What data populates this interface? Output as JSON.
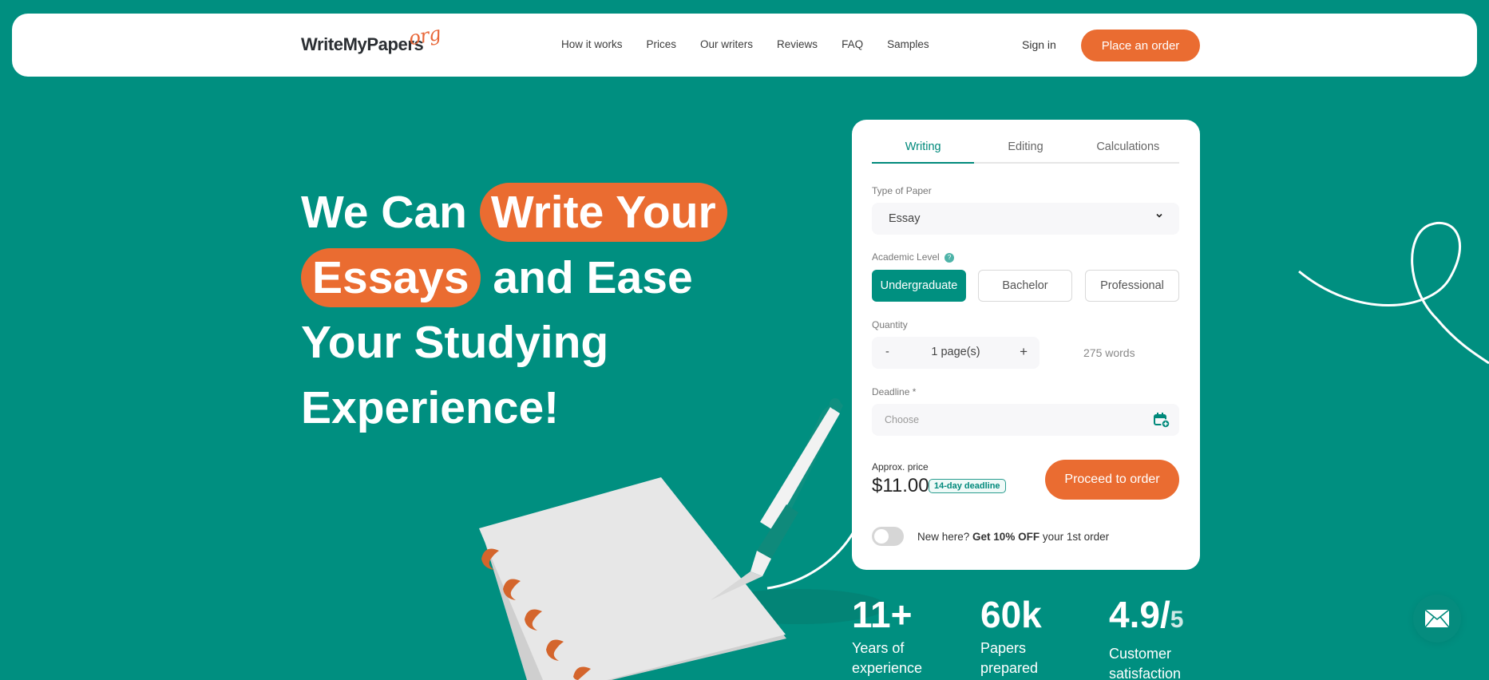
{
  "header": {
    "logo_main": "WriteMyPapers",
    "logo_suffix": "org",
    "nav": [
      "How it works",
      "Prices",
      "Our writers",
      "Reviews",
      "FAQ",
      "Samples"
    ],
    "sign_in": "Sign in",
    "place_order": "Place an order"
  },
  "hero": {
    "line1_plain": "We Can ",
    "line1_pill": "Write Your",
    "line2_pill": "Essays",
    "line2_plain": " and Ease",
    "line3": "Your Studying",
    "line4": "Experience!"
  },
  "order_form": {
    "tabs": [
      "Writing",
      "Editing",
      "Calculations"
    ],
    "active_tab": "Writing",
    "type_label": "Type of Paper",
    "type_value": "Essay",
    "level_label": "Academic Level",
    "levels": [
      "Undergraduate",
      "Bachelor",
      "Professional"
    ],
    "active_level": "Undergraduate",
    "quantity_label": "Quantity",
    "quantity_minus": "-",
    "quantity_value": "1 page(s)",
    "quantity_plus": "+",
    "words": "275 words",
    "deadline_label": "Deadline *",
    "deadline_placeholder": "Choose",
    "approx_label": "Approx. price",
    "price": "$11.00",
    "deadline_badge": "14-day deadline",
    "proceed": "Proceed to order",
    "promo_prefix": "New here? ",
    "promo_bold": "Get 10% OFF",
    "promo_suffix": " your 1st order",
    "promo_toggle_on": false
  },
  "stats": [
    {
      "value": "11+",
      "suffix": "",
      "label1": "Years of",
      "label2": "experience"
    },
    {
      "value": "60k",
      "suffix": "",
      "label1": "Papers",
      "label2": "prepared"
    },
    {
      "value": "4.9/",
      "suffix": "5",
      "label1": "Customer",
      "label2": "satisfaction"
    }
  ],
  "icons": {
    "chevron": "chevron-down-icon",
    "help": "?",
    "calendar": "calendar-add-icon",
    "mail": "mail-icon"
  },
  "colors": {
    "background": "#008f80",
    "accent": "#ea6c31",
    "primary": "#009080"
  }
}
